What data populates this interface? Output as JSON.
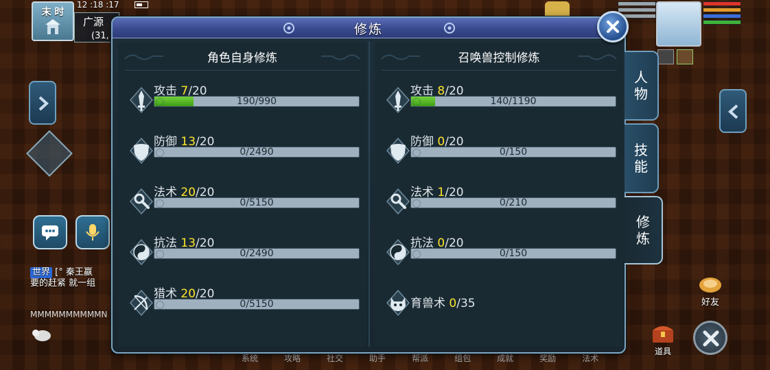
{
  "hud": {
    "time_label": "末 时",
    "clock": "12 :18 :17",
    "location_name": "广源",
    "location_coord": "(31,",
    "chat_channel": "世界",
    "chat_message": "[° 秦王嬴",
    "chat_message2": "要的赶紧 就一组",
    "chat_line3": "MMMMMMMMMMN",
    "friend_label": "好友",
    "items_label": "道具",
    "bottom_menu": [
      "系统",
      "攻略",
      "社交",
      "助手",
      "帮派",
      "组包",
      "成就",
      "奖励",
      "法术"
    ]
  },
  "dialog": {
    "title": "修炼",
    "left": {
      "header": "角色自身修炼",
      "rows": [
        {
          "icon": "attack-icon",
          "name": "攻击",
          "level": "7",
          "max": "/20",
          "progress_text": "190/990",
          "fill": 0.19
        },
        {
          "icon": "defense-icon",
          "name": "防御",
          "level": "13",
          "max": "/20",
          "progress_text": "0/2490",
          "fill": 0
        },
        {
          "icon": "magic-icon",
          "name": "法术",
          "level": "20",
          "max": "/20",
          "progress_text": "0/5150",
          "fill": 0
        },
        {
          "icon": "resist-icon",
          "name": "抗法",
          "level": "13",
          "max": "/20",
          "progress_text": "0/2490",
          "fill": 0
        },
        {
          "icon": "hunting-icon",
          "name": "猎术",
          "level": "20",
          "max": "/20",
          "progress_text": "0/5150",
          "fill": 0
        }
      ]
    },
    "right": {
      "header": "召唤兽控制修炼",
      "rows": [
        {
          "icon": "attack-icon",
          "name": "攻击",
          "level": "8",
          "max": "/20",
          "progress_text": "140/1190",
          "fill": 0.118
        },
        {
          "icon": "defense-icon",
          "name": "防御",
          "level": "0",
          "max": "/20",
          "progress_text": "0/150",
          "fill": 0
        },
        {
          "icon": "magic-icon",
          "name": "法术",
          "level": "1",
          "max": "/20",
          "progress_text": "0/210",
          "fill": 0
        },
        {
          "icon": "resist-icon",
          "name": "抗法",
          "level": "0",
          "max": "/20",
          "progress_text": "0/150",
          "fill": 0
        },
        {
          "icon": "beast-taming-icon",
          "name": "育兽术",
          "level": "0",
          "max": "/35",
          "progress_text": "",
          "fill": null
        }
      ]
    }
  },
  "tabs": [
    {
      "label": [
        "人",
        "物"
      ],
      "active": false
    },
    {
      "label": [
        "技",
        "能"
      ],
      "active": false
    },
    {
      "label": [
        "修",
        "炼"
      ],
      "active": true
    }
  ],
  "colors": {
    "level_highlight": "#ffe52d",
    "progress_fill": "#5fbf2a",
    "dialog_bg": "#1a2a33",
    "titlebar": "#3a4a8f"
  }
}
